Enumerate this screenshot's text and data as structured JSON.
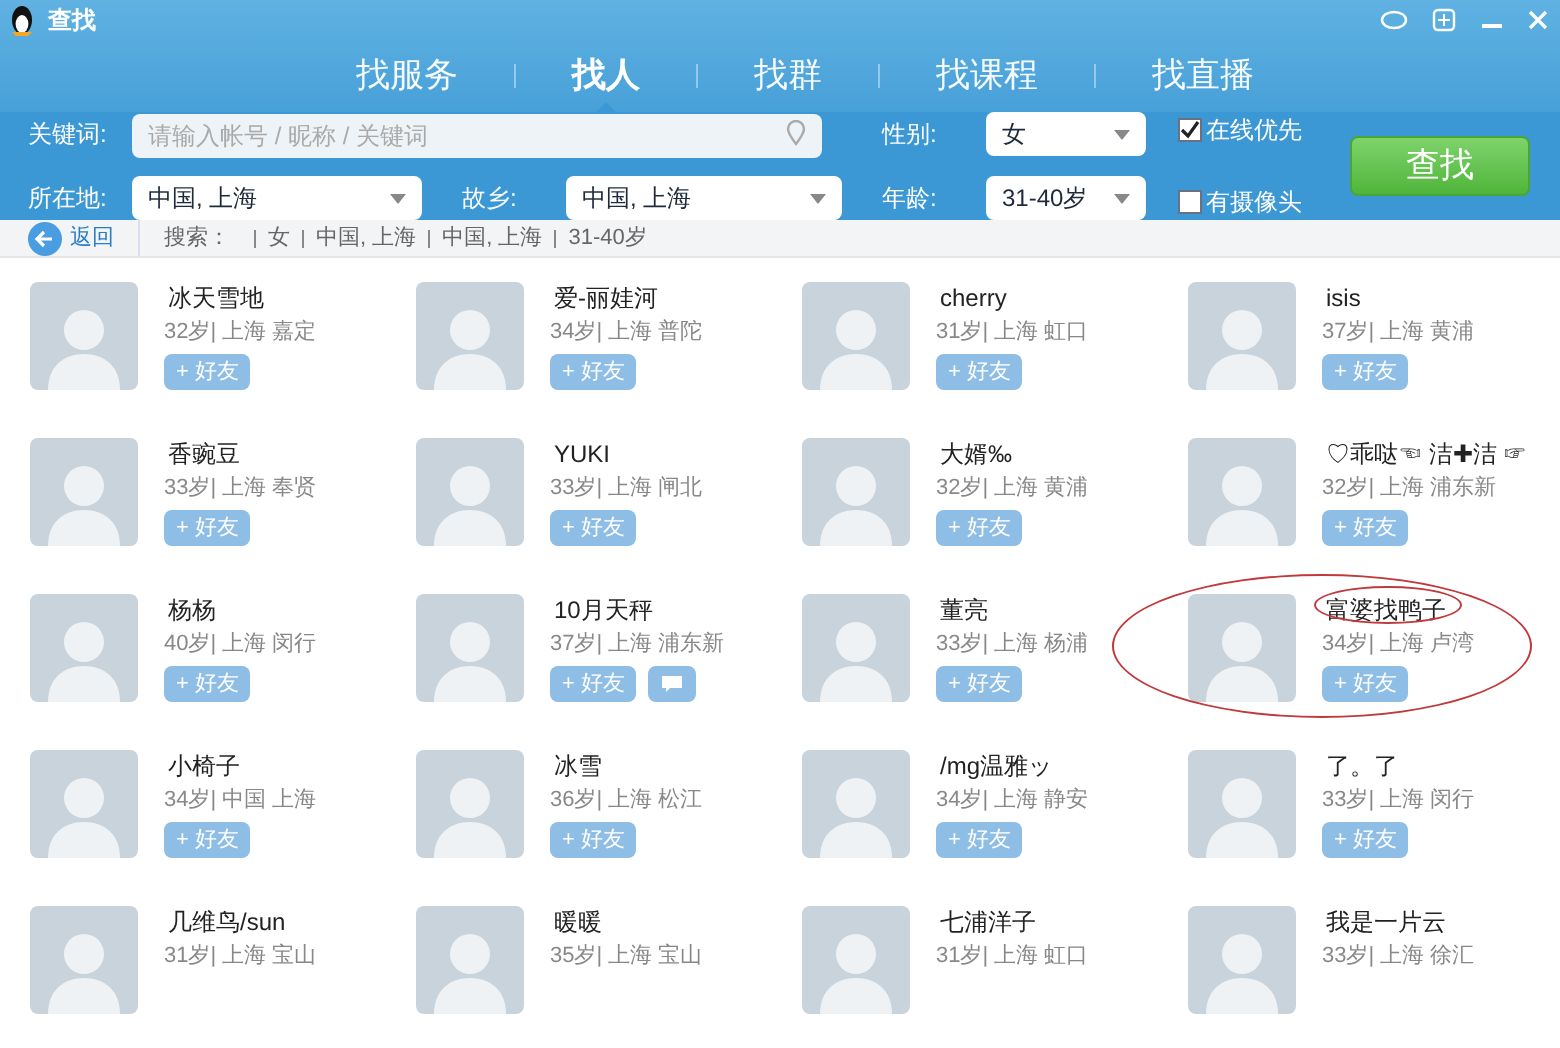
{
  "window": {
    "title": "查找"
  },
  "tabs": [
    {
      "label": "找服务",
      "selected": false
    },
    {
      "label": "找人",
      "selected": true
    },
    {
      "label": "找群",
      "selected": false
    },
    {
      "label": "找课程",
      "selected": false
    },
    {
      "label": "找直播",
      "selected": false
    }
  ],
  "filters": {
    "keyword": {
      "label": "关键词:",
      "placeholder": "请输入帐号 / 昵称 / 关键词"
    },
    "gender": {
      "label": "性别:",
      "value": "女"
    },
    "location": {
      "label": "所在地:",
      "value": "中国, 上海"
    },
    "hometown": {
      "label": "故乡:",
      "value": "中国, 上海"
    },
    "age": {
      "label": "年龄:",
      "value": "31-40岁"
    },
    "checkboxes": [
      {
        "label": "在线优先",
        "checked": true
      },
      {
        "label": "有摄像头",
        "checked": false
      }
    ],
    "search_button": "查找"
  },
  "breadcrumb": {
    "back": "返回",
    "label": "搜索：",
    "parts": [
      "女",
      "中国, 上海",
      "中国, 上海",
      "31-40岁"
    ]
  },
  "results": [
    {
      "name": "冰天雪地",
      "info": "32岁| 上海 嘉定",
      "add": "+ 好友",
      "message": false,
      "annotated": false
    },
    {
      "name": "爱-丽娃河",
      "info": "34岁| 上海 普陀",
      "add": "+ 好友",
      "message": false,
      "annotated": false
    },
    {
      "name": "cherry",
      "info": "31岁| 上海 虹口",
      "add": "+ 好友",
      "message": false,
      "annotated": false
    },
    {
      "name": "isis",
      "info": "37岁| 上海 黄浦",
      "add": "+ 好友",
      "message": false,
      "annotated": false
    },
    {
      "name": "香豌豆",
      "info": "33岁| 上海 奉贤",
      "add": "+ 好友",
      "message": false,
      "annotated": false
    },
    {
      "name": "YUKI",
      "info": "33岁| 上海 闸北",
      "add": "+ 好友",
      "message": false,
      "annotated": false
    },
    {
      "name": "大婿‰",
      "info": "32岁| 上海 黄浦",
      "add": "+ 好友",
      "message": false,
      "annotated": false
    },
    {
      "name": "♡乖哒☜ 洁✚洁 ☞",
      "info": "32岁| 上海 浦东新",
      "add": "+ 好友",
      "message": false,
      "annotated": false
    },
    {
      "name": "杨杨",
      "info": "40岁| 上海 闵行",
      "add": "+ 好友",
      "message": false,
      "annotated": false
    },
    {
      "name": "10月天秤",
      "info": "37岁| 上海 浦东新",
      "add": "+ 好友",
      "message": true,
      "annotated": false
    },
    {
      "name": "董亮",
      "info": "33岁| 上海 杨浦",
      "add": "+ 好友",
      "message": false,
      "annotated": false
    },
    {
      "name": "富婆找鸭子",
      "info": "34岁| 上海 卢湾",
      "add": "+ 好友",
      "message": false,
      "annotated": true
    },
    {
      "name": "小椅子",
      "info": "34岁| 中国 上海",
      "add": "+ 好友",
      "message": false,
      "annotated": false
    },
    {
      "name": "冰雪",
      "info": "36岁| 上海 松江",
      "add": "+ 好友",
      "message": false,
      "annotated": false
    },
    {
      "name": "/mg温雅ッ",
      "info": "34岁| 上海 静安",
      "add": "+ 好友",
      "message": false,
      "annotated": false
    },
    {
      "name": "了。了",
      "info": "33岁| 上海 闵行",
      "add": "+ 好友",
      "message": false,
      "annotated": false
    },
    {
      "name": "几维鸟/sun",
      "info": "31岁| 上海 宝山",
      "message": false,
      "annotated": false
    },
    {
      "name": "暖暖",
      "info": "35岁| 上海 宝山",
      "message": false,
      "annotated": false
    },
    {
      "name": "七浦洋子",
      "info": "31岁| 上海 虹口",
      "message": false,
      "annotated": false
    },
    {
      "name": "我是一片云",
      "info": "33岁| 上海 徐汇",
      "message": false,
      "annotated": false
    }
  ]
}
